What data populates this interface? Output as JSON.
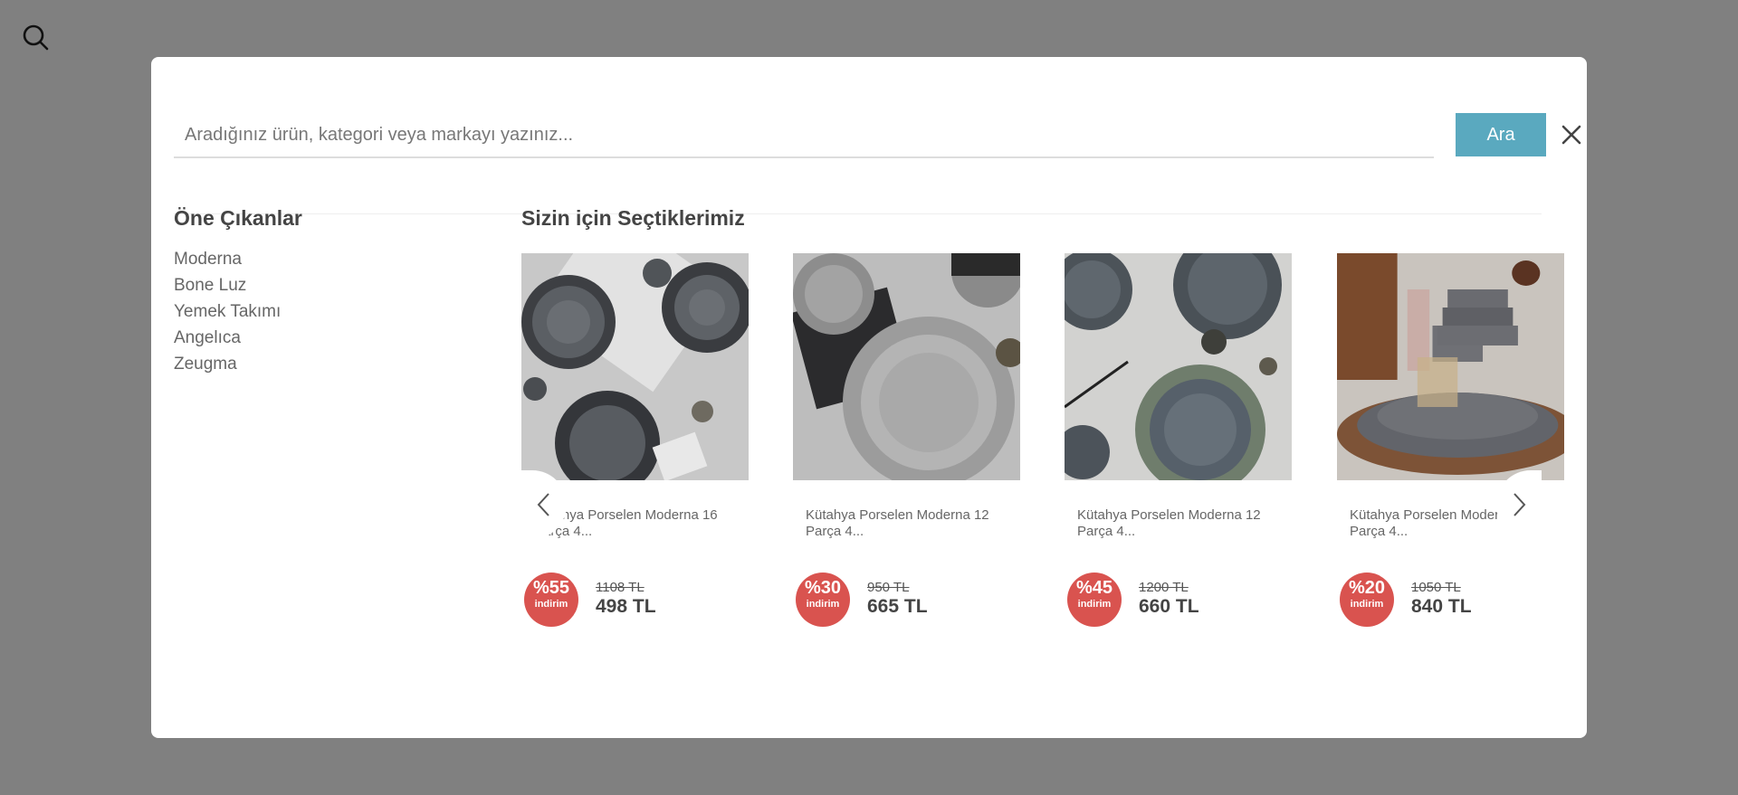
{
  "page": {
    "search_icon": "search-icon"
  },
  "search": {
    "placeholder": "Aradığınız ürün, kategori veya markayı yazınız...",
    "button_label": "Ara",
    "close_icon": "close-icon",
    "accent_color": "#5aa9bf"
  },
  "featured": {
    "title": "Öne Çıkanlar",
    "items": [
      "Moderna",
      "Bone Luz",
      "Yemek Takımı",
      "Angelıca",
      "Zeugma"
    ]
  },
  "picks": {
    "title": "Sizin için Seçtiklerimiz",
    "prev_icon": "chevron-left-icon",
    "next_icon": "chevron-right-icon",
    "products": [
      {
        "title": "Kütahya Porselen Moderna 16 Parça 4...",
        "discount": "%55",
        "discount_label": "indirim",
        "old_price": "1108 TL",
        "price": "498 TL"
      },
      {
        "title": "Kütahya Porselen Moderna 12 Parça 4...",
        "discount": "%30",
        "discount_label": "indirim",
        "old_price": "950 TL",
        "price": "665 TL"
      },
      {
        "title": "Kütahya Porselen Moderna 12 Parça 4...",
        "discount": "%45",
        "discount_label": "indirim",
        "old_price": "1200 TL",
        "price": "660 TL"
      },
      {
        "title": "Kütahya Porselen Moderna 12 Parça 4...",
        "discount": "%20",
        "discount_label": "indirim",
        "old_price": "1050 TL",
        "price": "840 TL"
      }
    ],
    "badge_color": "#d9534f"
  }
}
